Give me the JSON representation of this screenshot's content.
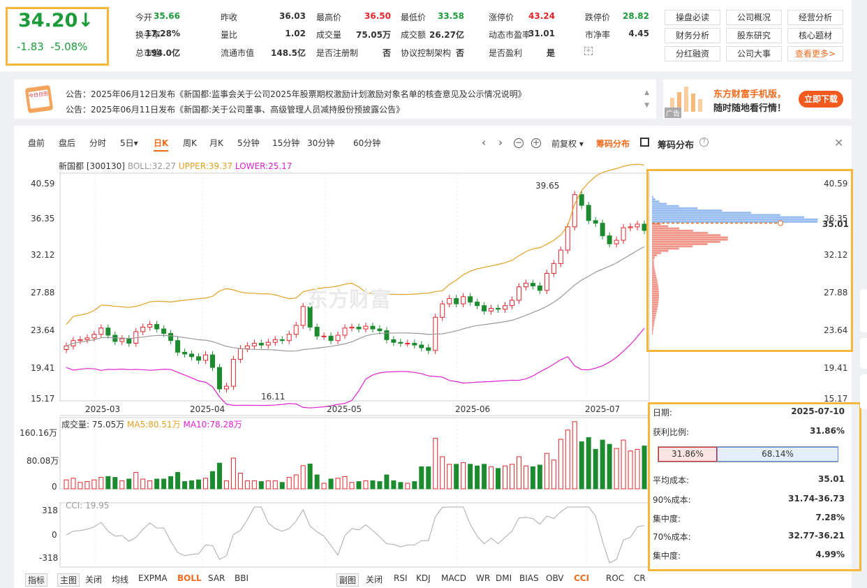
{
  "quote": {
    "price": "34.20↓",
    "change": "-1.83",
    "change_pct": "-5.08%",
    "fields": [
      {
        "label": "今开",
        "value": "35.66",
        "color": "green"
      },
      {
        "label": "昨收",
        "value": "36.03",
        "color": "dark"
      },
      {
        "label": "最高价",
        "value": "36.50",
        "color": "red"
      },
      {
        "label": "最低价",
        "value": "33.58",
        "color": "green"
      },
      {
        "label": "涨停价",
        "value": "43.24",
        "color": "red"
      },
      {
        "label": "跌停价",
        "value": "28.82",
        "color": "green"
      },
      {
        "label": "换手率",
        "value": "17.28%",
        "color": "dark"
      },
      {
        "label": "量比",
        "value": "1.02",
        "color": "dark"
      },
      {
        "label": "成交量",
        "value": "75.05万",
        "color": "dark"
      },
      {
        "label": "成交额",
        "value": "26.27亿",
        "color": "dark"
      },
      {
        "label": "动态市盈率",
        "value": "31.01",
        "color": "dark"
      },
      {
        "label": "市净率",
        "value": "4.45",
        "color": "dark"
      },
      {
        "label": "总市值",
        "value": "194.0亿",
        "color": "dark"
      },
      {
        "label": "流通市值",
        "value": "148.5亿",
        "color": "dark"
      },
      {
        "label": "是否注册制",
        "value": "否",
        "color": "dark"
      },
      {
        "label": "协议控制架构",
        "value": "否",
        "color": "dark"
      },
      {
        "label": "是否盈利",
        "value": "是",
        "color": "dark"
      }
    ]
  },
  "top_buttons": [
    "操盘必读",
    "公司概况",
    "经营分析",
    "财务分析",
    "股东研究",
    "核心题材",
    "分红融资",
    "公司大事",
    "查看更多>"
  ],
  "notices": [
    "公告：2025年06月12日发布《新国都:监事会关于公司2025年股票期权激励计划激励对象名单的核查意见及公示情况说明》",
    "公告：2025年06月11日发布《新国都:关于公司董事、高级管理人员减持股份预披露公告》"
  ],
  "calendar_label": "今日日历",
  "ad": {
    "line1": "东方财富手机版，",
    "line2": "随时随地看行情！",
    "button": "立即下载",
    "tag": "广告"
  },
  "period_tabs": [
    "盘前",
    "盘后",
    "分时",
    "5日▾",
    "日K",
    "周K",
    "月K",
    "5分钟",
    "15分钟",
    "30分钟",
    "60分钟"
  ],
  "active_tab": "日K",
  "toolbar": {
    "adjust": "前复权 ▾",
    "chip": "筹码分布",
    "chip_title": "筹码分布"
  },
  "legend": {
    "name": "新国都 [300130]",
    "boll": "BOLL:32.27",
    "upper": "UPPER:39.37",
    "lower": "LOWER:25.17"
  },
  "watermark": "东方财富",
  "price_axis": [
    "40.59",
    "36.35",
    "32.12",
    "27.88",
    "23.64",
    "19.41",
    "15.17"
  ],
  "current_price_label": "35.01",
  "date_axis": [
    "2025-03",
    "2025-04",
    "2025-05",
    "2025-06",
    "2025-07"
  ],
  "annotations": {
    "high": "39.65",
    "low": "16.11"
  },
  "volume": {
    "label": "成交量: 75.05万",
    "ma5": "MA5:80.51万",
    "ma10": "MA10:78.28万",
    "axis": [
      "160.16万",
      "80.08万",
      "0"
    ]
  },
  "cci": {
    "label": "CCI: 19.95",
    "axis": [
      "318",
      "0",
      "-318"
    ]
  },
  "chip_info": {
    "date_label": "日期:",
    "date": "2025-07-10",
    "profit_label": "获利比例:",
    "profit": "31.86%",
    "bar_left": "31.86%",
    "bar_right": "68.14%",
    "avg_label": "平均成本:",
    "avg": "35.01",
    "c90_label": "90%成本:",
    "c90": "31.74-36.73",
    "conc1_label": "集中度:",
    "conc1": "7.28%",
    "c70_label": "70%成本:",
    "c70": "32.77-36.21",
    "conc2_label": "集中度:",
    "conc2": "4.99%"
  },
  "bottom_left": [
    "指标",
    "主图",
    "关闭",
    "均线",
    "EXPMA",
    "BOLL",
    "SAR",
    "BBI"
  ],
  "bottom_right": [
    "副图",
    "关闭",
    "RSI",
    "KDJ",
    "MACD",
    "WR",
    "DMI",
    "BIAS",
    "OBV",
    "CCI",
    "ROC",
    "CR"
  ],
  "chart_data": {
    "type": "candlestick",
    "ylim": [
      15.17,
      40.59
    ],
    "price_range_shown": [
      15.17,
      40.59
    ],
    "candles_close_approx": [
      21.3,
      21.9,
      22.0,
      22.2,
      22.6,
      23.3,
      22.5,
      21.8,
      22.1,
      21.6,
      22.9,
      23.4,
      23.7,
      23.2,
      22.7,
      21.9,
      20.6,
      20.4,
      20.1,
      19.7,
      20.3,
      18.9,
      16.5,
      16.8,
      19.8,
      21.0,
      21.3,
      21.6,
      21.4,
      21.7,
      22.0,
      21.9,
      22.6,
      23.6,
      25.7,
      23.4,
      22.4,
      22.4,
      21.9,
      22.5,
      23.3,
      23.4,
      23.2,
      23.5,
      23.2,
      23.0,
      22.0,
      21.7,
      21.6,
      21.6,
      21.4,
      21.1,
      20.8,
      24.5,
      26.0,
      26.6,
      26.0,
      26.8,
      26.2,
      25.8,
      25.2,
      25.5,
      25.4,
      25.8,
      26.4,
      27.9,
      28.3,
      28.0,
      27.5,
      29.4,
      30.5,
      32.0,
      34.6,
      38.2,
      37.0,
      35.3,
      35.0,
      33.6,
      32.7,
      33.1,
      34.5,
      34.6,
      34.9,
      34.2
    ],
    "volume_axis_max": "160.16万",
    "cci_range": [
      -318,
      318
    ]
  }
}
